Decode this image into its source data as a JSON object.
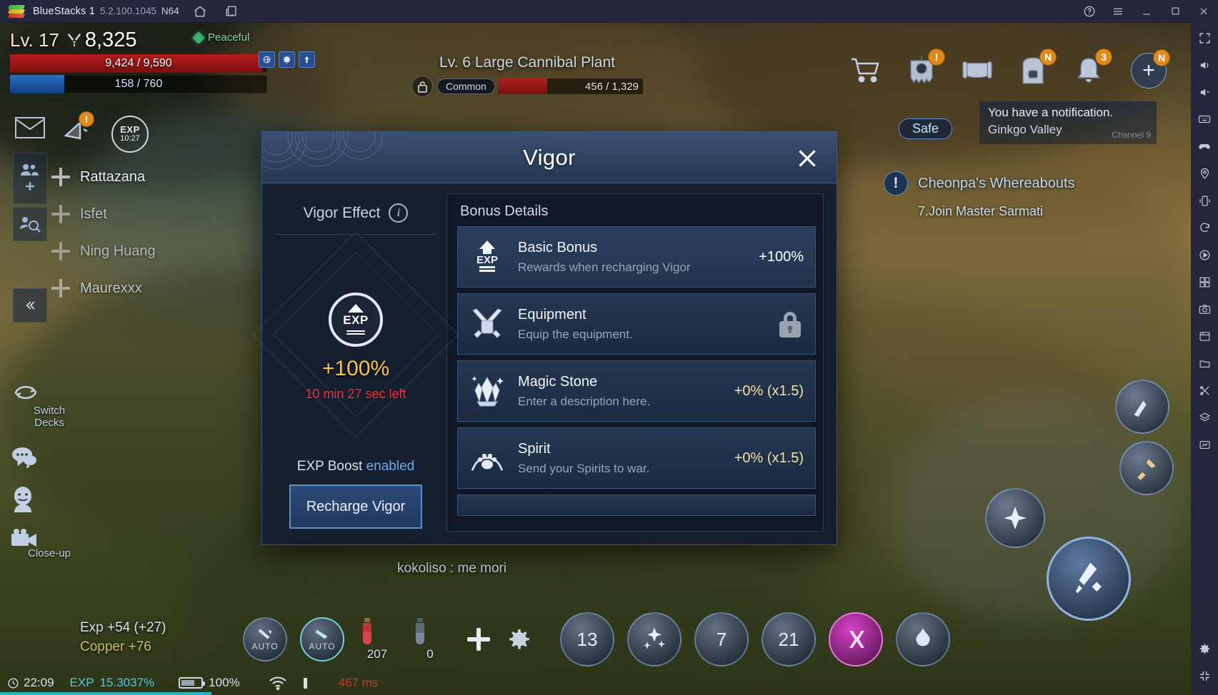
{
  "bluestacks": {
    "app_name": "BlueStacks 1",
    "version": "5.2.100.1045",
    "arch": "N64",
    "titlebar_icons": [
      "home-icon",
      "multi-instance-icon"
    ],
    "window_controls": [
      "help-icon",
      "menu-icon",
      "minimize-icon",
      "maximize-icon",
      "close-icon"
    ],
    "rail_icons": [
      "fullscreen-icon",
      "volume-icon",
      "volume-down-icon",
      "keyboard-icon",
      "gamepad-icon",
      "location-icon",
      "shake-icon",
      "rotate-icon",
      "macro-icon",
      "multi-instance-sync-icon",
      "screenshot-icon",
      "media-manager-icon",
      "file-transfer-icon",
      "trim-icon",
      "layers-icon",
      "eco-mode-icon",
      "settings-icon",
      "fullscreen-exit-icon"
    ]
  },
  "hud": {
    "player": {
      "level_label": "Lv. 17",
      "power": "8,325",
      "hp": "9,424 / 9,590",
      "hp_pct": 98,
      "mp": "158 / 760",
      "mp_pct": 21,
      "mode": "Peaceful"
    },
    "exp_timer": {
      "label": "EXP",
      "time": "10:27"
    },
    "party_members": [
      "Rattazana",
      "Isfet",
      "Ning Huang",
      "Maurexxx"
    ],
    "left_tools": [
      {
        "name": "mail-icon"
      },
      {
        "name": "megaphone-icon",
        "badge": "!"
      },
      {
        "name": "party-add-icon"
      },
      {
        "name": "find-party-icon"
      },
      {
        "name": "collapse-icon"
      }
    ],
    "bottom_left_tools": [
      {
        "icon": "switch-decks-icon",
        "label": "Switch\nDecks"
      },
      {
        "icon": "chat-bubble-icon",
        "label": ""
      },
      {
        "icon": "emote-icon",
        "label": ""
      },
      {
        "icon": "camera-icon",
        "label": "Close-up"
      }
    ],
    "gain_overlay": {
      "exp_line": "Exp +54 (+27)",
      "copper_line": "Copper +76"
    },
    "status_bar": {
      "clock": "22:09",
      "exp_label": "EXP",
      "exp_value": "15.3037%",
      "battery": "100%",
      "wifi": "wifi-icon",
      "signal": "signal-icon",
      "ping": "467 ms"
    },
    "chat_line": "kokoliso : me mori",
    "safe_tag": "Safe",
    "notification": {
      "line1": "You have a notification.",
      "line2": "Ginkgo Valley",
      "channel": "Channel 9"
    },
    "quest": {
      "title": "Cheonpa's Whereabouts",
      "step": "7.Join Master Sarmati"
    },
    "top_right_icons": [
      {
        "name": "shop-cart-icon",
        "badge": ""
      },
      {
        "name": "guild-banner-icon",
        "badge": "!"
      },
      {
        "name": "scroll-icon",
        "badge": ""
      },
      {
        "name": "backpack-icon",
        "badge": "N"
      },
      {
        "name": "bell-icon",
        "badge": "3"
      },
      {
        "name": "more-plus-icon",
        "badge": "N"
      }
    ],
    "minibuttons": [
      "map-icon",
      "settings-icon",
      "boost-icon"
    ],
    "action_bar": {
      "slots": [
        {
          "name": "auto-attack-slot",
          "label": "AUTO"
        },
        {
          "name": "auto-battle-slot",
          "label": "AUTO"
        },
        {
          "name": "hp-potion-slot",
          "count": "207"
        },
        {
          "name": "mp-potion-slot",
          "count": "0"
        },
        {
          "name": "add-slot",
          "count": ""
        },
        {
          "name": "settings-slot",
          "count": ""
        },
        {
          "name": "skill-slot-13",
          "count": "13"
        },
        {
          "name": "skill-slot-buff",
          "count": ""
        },
        {
          "name": "skill-slot-7",
          "count": "7"
        },
        {
          "name": "skill-slot-21",
          "count": "21"
        },
        {
          "name": "skill-slot-magic",
          "count": ""
        },
        {
          "name": "skill-slot-wind",
          "count": ""
        }
      ]
    }
  },
  "enemy": {
    "level_label": "Lv. 6",
    "name": "Large Cannibal Plant",
    "grade": "Common",
    "hp": "456 / 1,329",
    "hp_pct": 34
  },
  "modal": {
    "title": "Vigor",
    "close_icon": "close-icon",
    "left": {
      "section_title": "Vigor Effect",
      "info_icon": "info-icon",
      "badge_icon": "exp-boost-icon",
      "badge_text": "EXP",
      "percent": "+100%",
      "time_left": "10 min 27 sec left",
      "boost_prefix": "EXP Boost ",
      "boost_state": "enabled",
      "recharge_button": "Recharge Vigor"
    },
    "right": {
      "section_title": "Bonus Details",
      "rows": [
        {
          "icon": "exp-arrow-icon",
          "name": "Basic Bonus",
          "desc": "Rewards when recharging Vigor",
          "value": "+100%",
          "locked": false,
          "highlight": true
        },
        {
          "icon": "crossed-swords-icon",
          "name": "Equipment",
          "desc": "Equip the equipment.",
          "value": "",
          "locked": true,
          "highlight": false
        },
        {
          "icon": "magic-stone-icon",
          "name": "Magic Stone",
          "desc": "Enter a description here.",
          "value": "+0% (x1.5)",
          "locked": false,
          "highlight": false
        },
        {
          "icon": "spirit-paw-icon",
          "name": "Spirit",
          "desc": "Send your Spirits to war.",
          "value": "+0% (x1.5)",
          "locked": false,
          "highlight": false
        }
      ]
    }
  }
}
